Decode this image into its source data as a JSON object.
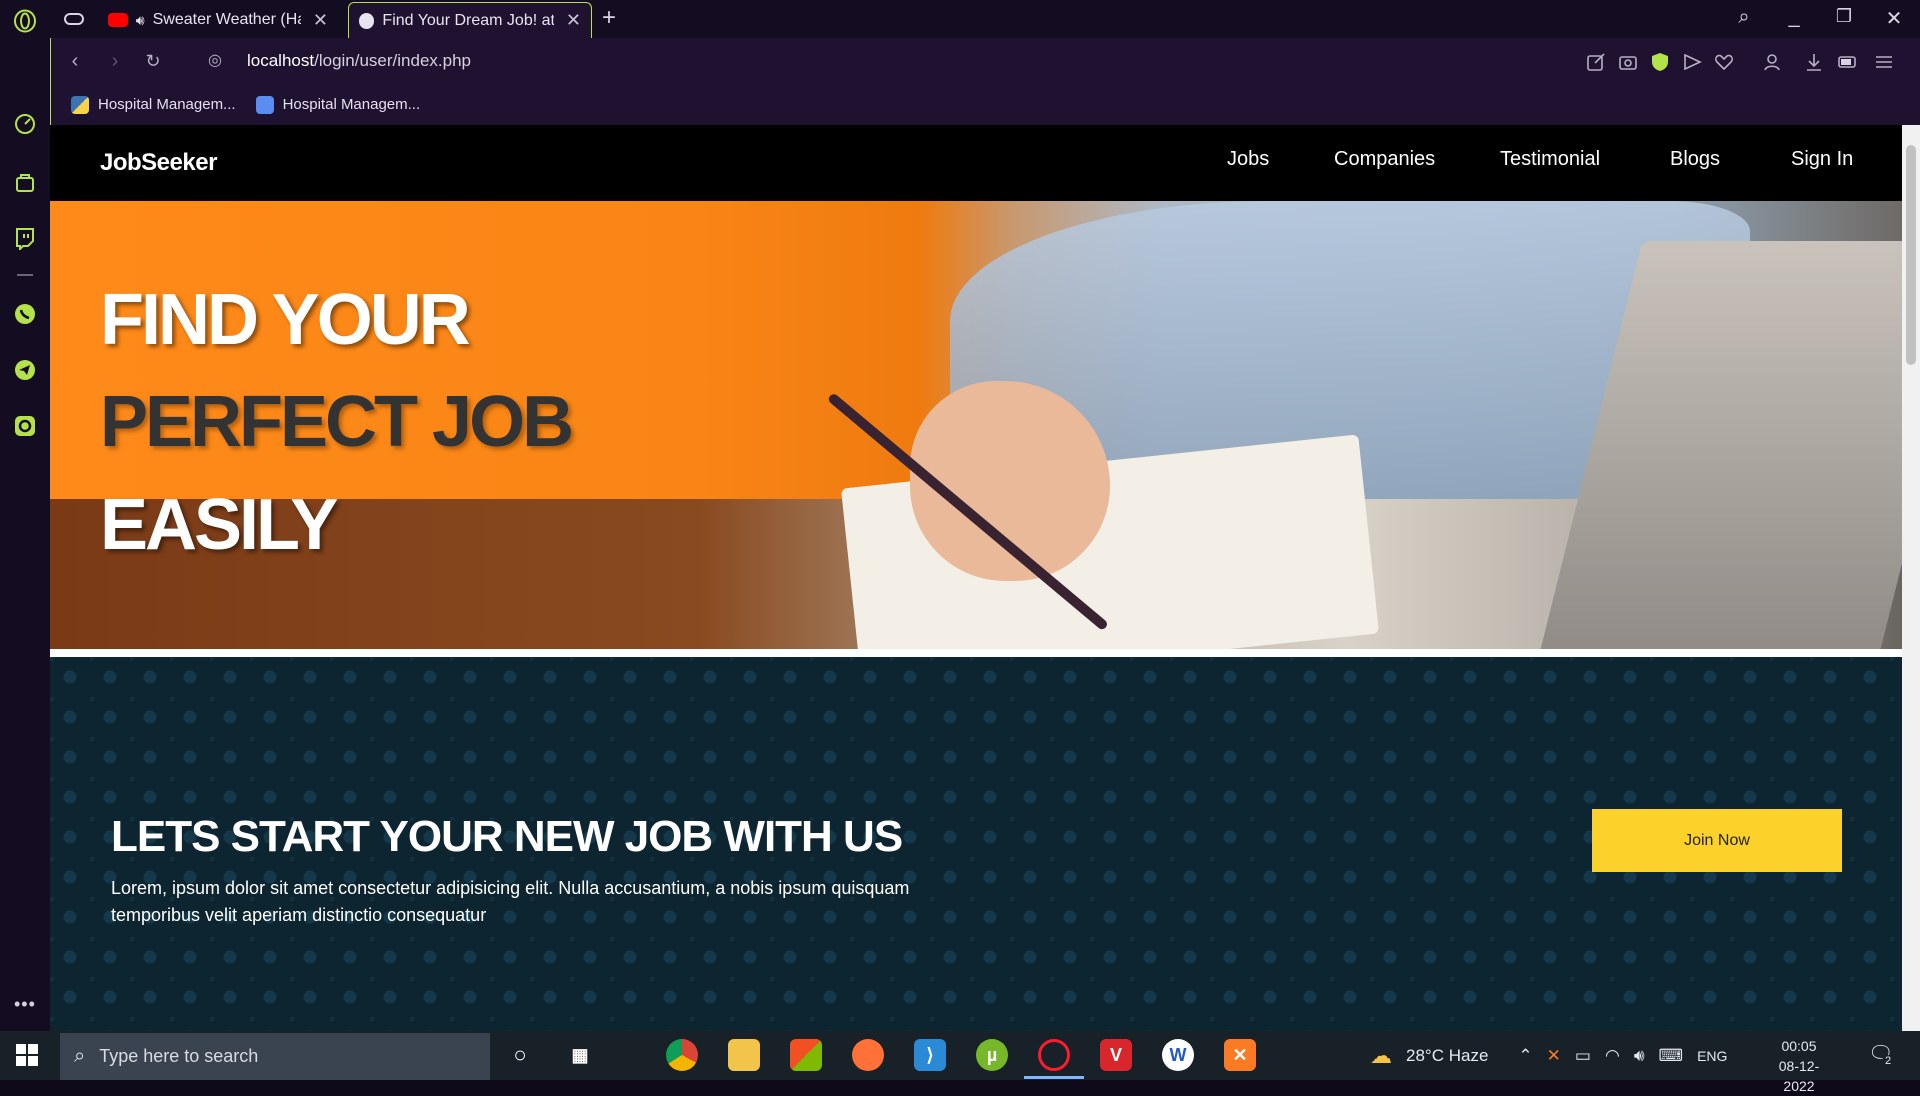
{
  "browser": {
    "tabs": [
      {
        "title": "Sweater Weather (Hard",
        "favicon": "youtube-icon",
        "audio": true
      },
      {
        "title": "Find Your Dream Job! at Jo",
        "favicon": "globe-icon",
        "active": true
      }
    ],
    "url_host": "localhost",
    "url_path": "/login/user/index.php",
    "bookmarks": [
      {
        "label": "Hospital Managem..."
      },
      {
        "label": "Hospital Managem..."
      }
    ]
  },
  "site": {
    "brand": "JobSeeker",
    "nav": [
      "Jobs",
      "Companies",
      "Testimonial",
      "Blogs",
      "Sign In"
    ],
    "hero": {
      "line1": "FIND YOUR",
      "line2": "PERFECT JOB",
      "line3": "EASILY"
    },
    "cta": {
      "title": "LETS START YOUR NEW JOB WITH US",
      "text": "Lorem, ipsum dolor sit amet consectetur adipisicing elit. Nulla accusantium, a nobis ipsum quisquam temporibus velit aperiam distinctio consequatur",
      "button": "Join Now"
    }
  },
  "taskbar": {
    "search_placeholder": "Type here to search",
    "weather": "28°C  Haze",
    "language": "ENG",
    "time": "00:05",
    "date": "08-12-2022",
    "notification_count": "2"
  },
  "colors": {
    "accent": "#b4e24a",
    "cta_button": "#fcd22a",
    "cta_background": "#0d2530",
    "hero_orange": "#ff8a1a"
  }
}
